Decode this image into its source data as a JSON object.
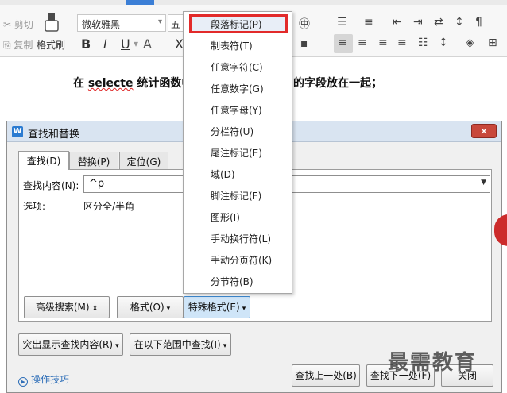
{
  "ribbon": {
    "cut": "剪切",
    "copy": "复制",
    "format_painter": "格式刷",
    "font_name": "微软雅黑",
    "font_size": "五",
    "bold": "B",
    "italic": "I",
    "underline": "U",
    "strike": "X"
  },
  "document": {
    "line_before": "在 ",
    "line_word": "selecte",
    "line_after": " 统计函数中",
    "line_tail": "的字段放在一起；"
  },
  "dialog": {
    "title": "查找和替换",
    "close": "×",
    "tabs": [
      "查找(D)",
      "替换(P)",
      "定位(G)"
    ],
    "find_label": "查找内容(N):",
    "find_value": "^p",
    "options_label": "选项:",
    "options_value": "区分全/半角",
    "advanced_search": "高级搜索(M)",
    "format": "格式(O)",
    "special_format": "特殊格式(E)",
    "highlight_found": "突出显示查找内容(R)",
    "find_in_range": "在以下范围中查找(I)",
    "tips": "操作技巧",
    "find_prev": "查找上一处(B)",
    "find_next": "查找下一处(F)",
    "close_btn": "关闭"
  },
  "menu": {
    "items": [
      "段落标记(P)",
      "制表符(T)",
      "任意字符(C)",
      "任意数字(G)",
      "任意字母(Y)",
      "分栏符(U)",
      "尾注标记(E)",
      "域(D)",
      "脚注标记(F)",
      "图形(I)",
      "手动换行符(L)",
      "手动分页符(K)",
      "分节符(B)"
    ]
  },
  "watermark": "最需教育"
}
